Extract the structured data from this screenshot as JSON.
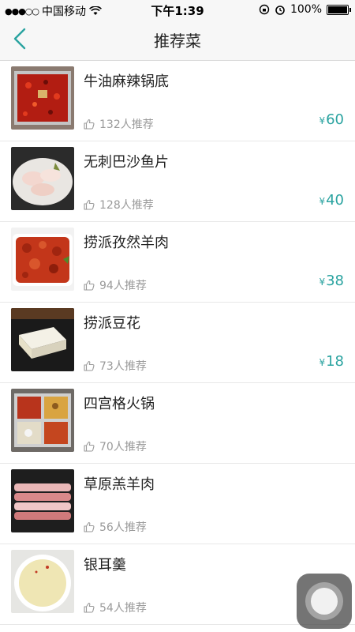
{
  "status_bar": {
    "carrier": "中国移动",
    "time": "下午1:39",
    "battery": "100%"
  },
  "nav": {
    "title": "推荐菜"
  },
  "colors": {
    "accent": "#2aa3a0"
  },
  "dishes": [
    {
      "name": "牛油麻辣锅底",
      "recommend": "132人推荐",
      "currency": "¥",
      "price": "60"
    },
    {
      "name": "无刺巴沙鱼片",
      "recommend": "128人推荐",
      "currency": "¥",
      "price": "40"
    },
    {
      "name": "捞派孜然羊肉",
      "recommend": "94人推荐",
      "currency": "¥",
      "price": "38"
    },
    {
      "name": "捞派豆花",
      "recommend": "73人推荐",
      "currency": "¥",
      "price": "18"
    },
    {
      "name": "四宫格火锅",
      "recommend": "70人推荐",
      "currency": "",
      "price": ""
    },
    {
      "name": "草原羔羊肉",
      "recommend": "56人推荐",
      "currency": "",
      "price": ""
    },
    {
      "name": "银耳羹",
      "recommend": "54人推荐",
      "currency": "",
      "price": ""
    }
  ]
}
